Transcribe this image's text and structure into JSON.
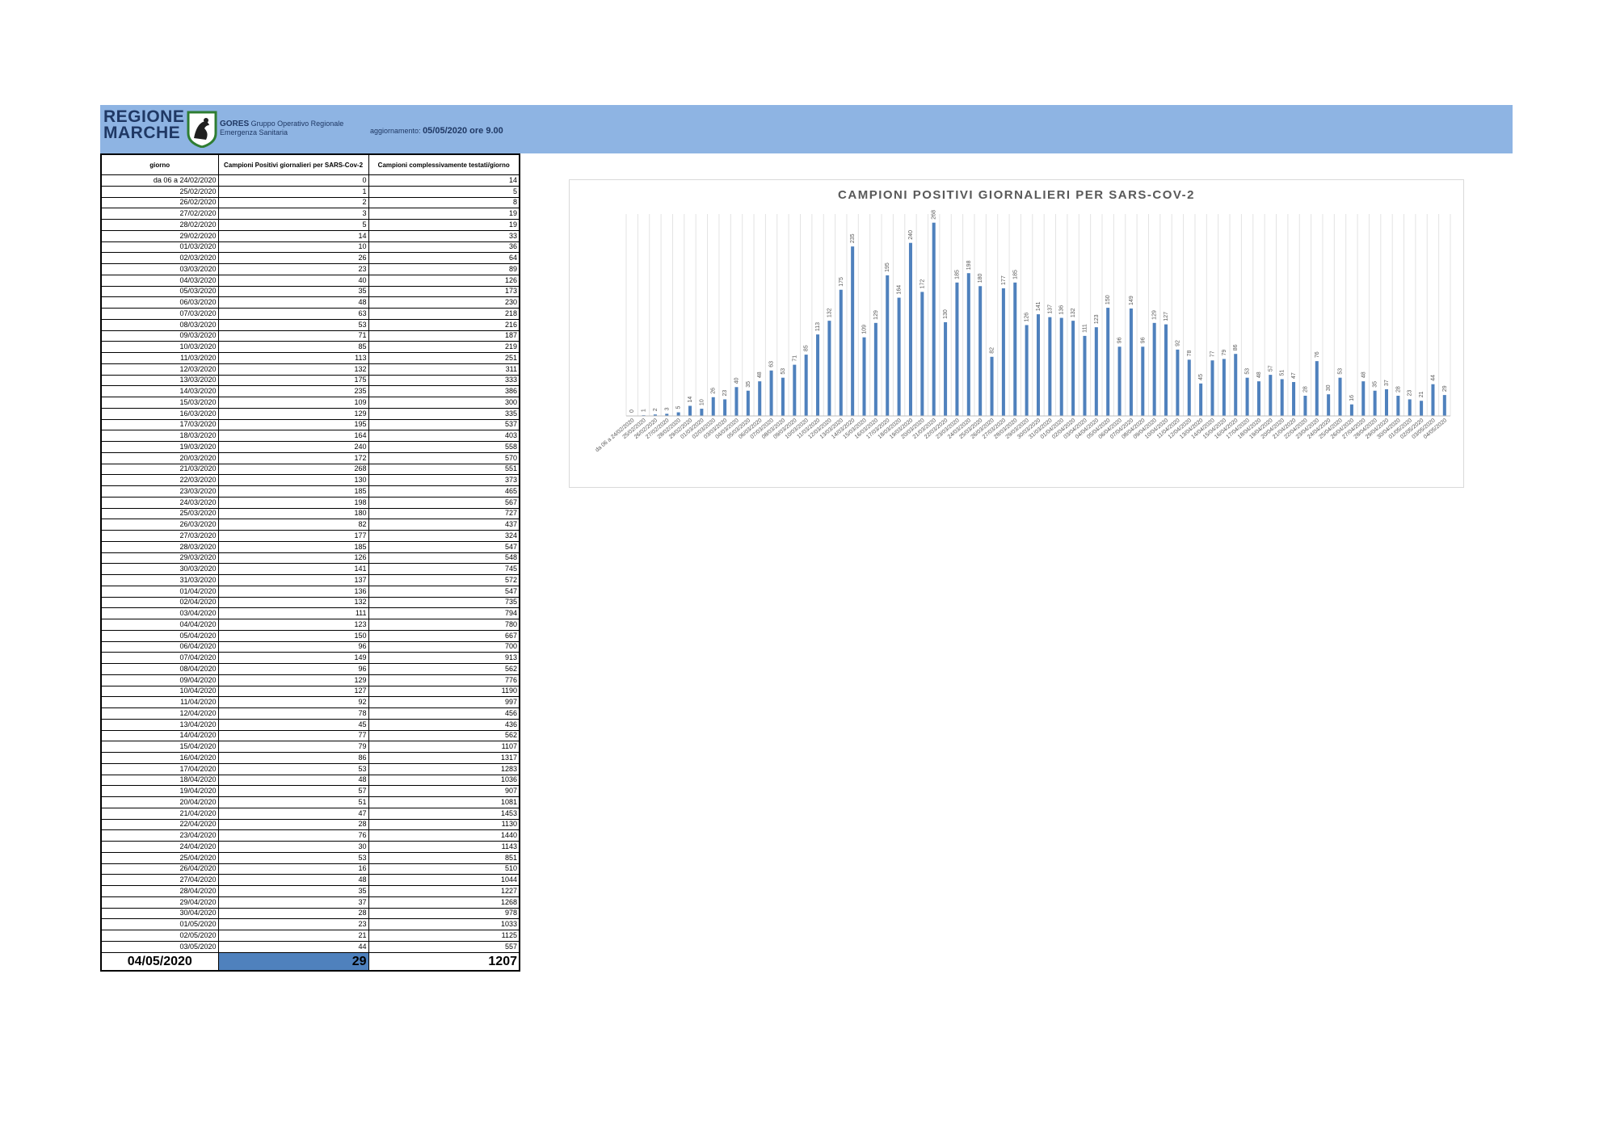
{
  "header": {
    "logo_text": "REGIONE MARCHE",
    "org_name": "GORES",
    "org_subtitle_1": "Gruppo Operativo Regionale",
    "org_subtitle_2": "Emergenza Sanitaria",
    "update_label": "aggiornamento:",
    "update_value": "05/05/2020 ore 9.00"
  },
  "table": {
    "headers": [
      "giorno",
      "Campioni Positivi giornalieri per SARS-Cov-2",
      "Campioni complessivamente testati/giorno"
    ],
    "rows": [
      [
        "da 06 a 24/02/2020",
        "0",
        "14"
      ],
      [
        "25/02/2020",
        "1",
        "5"
      ],
      [
        "26/02/2020",
        "2",
        "8"
      ],
      [
        "27/02/2020",
        "3",
        "19"
      ],
      [
        "28/02/2020",
        "5",
        "19"
      ],
      [
        "29/02/2020",
        "14",
        "33"
      ],
      [
        "01/03/2020",
        "10",
        "36"
      ],
      [
        "02/03/2020",
        "26",
        "64"
      ],
      [
        "03/03/2020",
        "23",
        "89"
      ],
      [
        "04/03/2020",
        "40",
        "126"
      ],
      [
        "05/03/2020",
        "35",
        "173"
      ],
      [
        "06/03/2020",
        "48",
        "230"
      ],
      [
        "07/03/2020",
        "63",
        "218"
      ],
      [
        "08/03/2020",
        "53",
        "216"
      ],
      [
        "09/03/2020",
        "71",
        "187"
      ],
      [
        "10/03/2020",
        "85",
        "219"
      ],
      [
        "11/03/2020",
        "113",
        "251"
      ],
      [
        "12/03/2020",
        "132",
        "311"
      ],
      [
        "13/03/2020",
        "175",
        "333"
      ],
      [
        "14/03/2020",
        "235",
        "386"
      ],
      [
        "15/03/2020",
        "109",
        "300"
      ],
      [
        "16/03/2020",
        "129",
        "335"
      ],
      [
        "17/03/2020",
        "195",
        "537"
      ],
      [
        "18/03/2020",
        "164",
        "403"
      ],
      [
        "19/03/2020",
        "240",
        "558"
      ],
      [
        "20/03/2020",
        "172",
        "570"
      ],
      [
        "21/03/2020",
        "268",
        "551"
      ],
      [
        "22/03/2020",
        "130",
        "373"
      ],
      [
        "23/03/2020",
        "185",
        "465"
      ],
      [
        "24/03/2020",
        "198",
        "567"
      ],
      [
        "25/03/2020",
        "180",
        "727"
      ],
      [
        "26/03/2020",
        "82",
        "437"
      ],
      [
        "27/03/2020",
        "177",
        "324"
      ],
      [
        "28/03/2020",
        "185",
        "547"
      ],
      [
        "29/03/2020",
        "126",
        "548"
      ],
      [
        "30/03/2020",
        "141",
        "745"
      ],
      [
        "31/03/2020",
        "137",
        "572"
      ],
      [
        "01/04/2020",
        "136",
        "547"
      ],
      [
        "02/04/2020",
        "132",
        "735"
      ],
      [
        "03/04/2020",
        "111",
        "794"
      ],
      [
        "04/04/2020",
        "123",
        "780"
      ],
      [
        "05/04/2020",
        "150",
        "667"
      ],
      [
        "06/04/2020",
        "96",
        "700"
      ],
      [
        "07/04/2020",
        "149",
        "913"
      ],
      [
        "08/04/2020",
        "96",
        "562"
      ],
      [
        "09/04/2020",
        "129",
        "776"
      ],
      [
        "10/04/2020",
        "127",
        "1190"
      ],
      [
        "11/04/2020",
        "92",
        "997"
      ],
      [
        "12/04/2020",
        "78",
        "456"
      ],
      [
        "13/04/2020",
        "45",
        "436"
      ],
      [
        "14/04/2020",
        "77",
        "562"
      ],
      [
        "15/04/2020",
        "79",
        "1107"
      ],
      [
        "16/04/2020",
        "86",
        "1317"
      ],
      [
        "17/04/2020",
        "53",
        "1283"
      ],
      [
        "18/04/2020",
        "48",
        "1036"
      ],
      [
        "19/04/2020",
        "57",
        "907"
      ],
      [
        "20/04/2020",
        "51",
        "1081"
      ],
      [
        "21/04/2020",
        "47",
        "1453"
      ],
      [
        "22/04/2020",
        "28",
        "1130"
      ],
      [
        "23/04/2020",
        "76",
        "1440"
      ],
      [
        "24/04/2020",
        "30",
        "1143"
      ],
      [
        "25/04/2020",
        "53",
        "851"
      ],
      [
        "26/04/2020",
        "16",
        "510"
      ],
      [
        "27/04/2020",
        "48",
        "1044"
      ],
      [
        "28/04/2020",
        "35",
        "1227"
      ],
      [
        "29/04/2020",
        "37",
        "1268"
      ],
      [
        "30/04/2020",
        "28",
        "978"
      ],
      [
        "01/05/2020",
        "23",
        "1033"
      ],
      [
        "02/05/2020",
        "21",
        "1125"
      ],
      [
        "03/05/2020",
        "44",
        "557"
      ]
    ],
    "last_row": [
      "04/05/2020",
      "29",
      "1207"
    ]
  },
  "chart_data": {
    "type": "bar",
    "title": "CAMPIONI POSITIVI GIORNALIERI PER SARS-COV-2",
    "xlabel": "",
    "ylabel": "",
    "categories": [
      "da 06 a 24/02/2020",
      "25/02/2020",
      "26/02/2020",
      "27/02/2020",
      "28/02/2020",
      "29/02/2020",
      "01/03/2020",
      "02/03/2020",
      "03/03/2020",
      "04/03/2020",
      "05/03/2020",
      "06/03/2020",
      "07/03/2020",
      "08/03/2020",
      "09/03/2020",
      "10/03/2020",
      "11/03/2020",
      "12/03/2020",
      "13/03/2020",
      "14/03/2020",
      "15/03/2020",
      "16/03/2020",
      "17/03/2020",
      "18/03/2020",
      "19/03/2020",
      "20/03/2020",
      "21/03/2020",
      "22/03/2020",
      "23/03/2020",
      "24/03/2020",
      "25/03/2020",
      "26/03/2020",
      "27/03/2020",
      "28/03/2020",
      "29/03/2020",
      "30/03/2020",
      "31/03/2020",
      "01/04/2020",
      "02/04/2020",
      "03/04/2020",
      "04/04/2020",
      "05/04/2020",
      "06/04/2020",
      "07/04/2020",
      "08/04/2020",
      "09/04/2020",
      "10/04/2020",
      "11/04/2020",
      "12/04/2020",
      "13/04/2020",
      "14/04/2020",
      "15/04/2020",
      "16/04/2020",
      "17/04/2020",
      "18/04/2020",
      "19/04/2020",
      "20/04/2020",
      "21/04/2020",
      "22/04/2020",
      "23/04/2020",
      "24/04/2020",
      "25/04/2020",
      "26/04/2020",
      "27/04/2020",
      "28/04/2020",
      "29/04/2020",
      "30/04/2020",
      "01/05/2020",
      "02/05/2020",
      "03/05/2020",
      "04/05/2020"
    ],
    "values": [
      0,
      1,
      2,
      3,
      5,
      14,
      10,
      26,
      23,
      40,
      35,
      48,
      63,
      53,
      71,
      85,
      113,
      132,
      175,
      235,
      109,
      129,
      195,
      164,
      240,
      172,
      268,
      130,
      185,
      198,
      180,
      82,
      177,
      185,
      126,
      141,
      137,
      136,
      132,
      111,
      123,
      150,
      96,
      149,
      96,
      129,
      127,
      92,
      78,
      45,
      77,
      79,
      86,
      53,
      48,
      57,
      51,
      47,
      28,
      76,
      30,
      53,
      16,
      48,
      35,
      37,
      28,
      23,
      21,
      44,
      29
    ],
    "ylim": [
      0,
      280
    ],
    "grid": true,
    "bar_color": "#4f81bd"
  }
}
